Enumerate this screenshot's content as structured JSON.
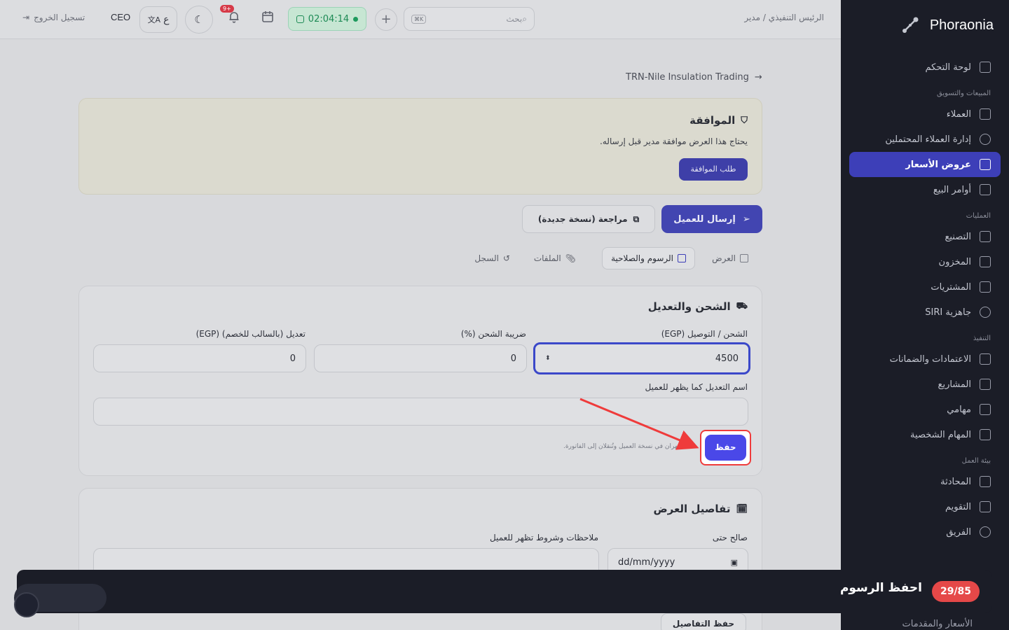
{
  "sidebar": {
    "brand": "Phoraonia",
    "sections": [
      {
        "title": "",
        "items": [
          {
            "label": "لوحة التحكم",
            "icon": "grid-icon",
            "active": false
          }
        ]
      },
      {
        "title": "المبيعات والتسويق",
        "items": [
          {
            "label": "العملاء",
            "icon": "contacts-icon",
            "active": false
          },
          {
            "label": "إدارة العملاء المحتملين",
            "icon": "target-icon",
            "active": false
          },
          {
            "label": "عروض الأسعار",
            "icon": "document-icon",
            "active": true
          },
          {
            "label": "أوامر البيع",
            "icon": "clipboard-icon",
            "active": false
          }
        ]
      },
      {
        "title": "العمليات",
        "items": [
          {
            "label": "التصنيع",
            "icon": "factory-icon",
            "active": false
          },
          {
            "label": "المخزون",
            "icon": "warehouse-icon",
            "active": false
          },
          {
            "label": "المشتريات",
            "icon": "cart-icon",
            "active": false
          },
          {
            "label": "جاهزية SIRI",
            "icon": "gauge-icon",
            "active": false
          }
        ]
      },
      {
        "title": "التنفيذ",
        "items": [
          {
            "label": "الاعتمادات والضمانات",
            "icon": "file-check-icon",
            "active": false
          },
          {
            "label": "المشاريع",
            "icon": "folder-icon",
            "active": false
          },
          {
            "label": "مهامي",
            "icon": "list-check-icon",
            "active": false
          },
          {
            "label": "المهام الشخصية",
            "icon": "clipboard-list-icon",
            "active": false
          }
        ]
      },
      {
        "title": "بيئة العمل",
        "items": [
          {
            "label": "المحادثة",
            "icon": "chat-icon",
            "active": false
          },
          {
            "label": "التقويم",
            "icon": "calendar-icon",
            "active": false
          },
          {
            "label": "الفريق",
            "icon": "users-icon",
            "active": false
          }
        ]
      }
    ],
    "bottom_item": "الأسعار والمقدمات"
  },
  "topbar": {
    "breadcrumb": "الرئيس التنفيذي / مدير",
    "search_placeholder": "بحث",
    "search_shortcut": "K⌘",
    "timer": "02:04:14",
    "notification_count": "+9",
    "lang_label": "ع",
    "role": "CEO",
    "logout": "تسجيل الخروج"
  },
  "main": {
    "back_link": "TRN-Nile Insulation Trading",
    "approval": {
      "title": "الموافقة",
      "text": "يحتاج هذا العرض موافقة مدير قبل إرساله.",
      "button": "طلب الموافقة"
    },
    "actions": {
      "send": "إرسال للعميل",
      "revise": "مراجعة (نسخة جديدة)"
    },
    "tabs": [
      {
        "label": "العرض",
        "icon": "document-icon",
        "active": false
      },
      {
        "label": "الرسوم والصلاحية",
        "icon": "receipt-icon",
        "active": true
      },
      {
        "label": "الملفات",
        "icon": "paperclip-icon",
        "active": false
      },
      {
        "label": "السجل",
        "icon": "history-icon",
        "active": false
      }
    ],
    "shipping": {
      "title": "الشحن والتعديل",
      "shipping_label": "الشحن / التوصيل (EGP)",
      "shipping_value": "4500",
      "tax_label": "ضريبة الشحن (%)",
      "tax_value": "0",
      "adjust_label": "تعديل (بالسالب للخصم) (EGP)",
      "adjust_value": "0",
      "adjust_name_label": "اسم التعديل كما يظهر للعميل",
      "adjust_name_value": "",
      "hint": "تظهران في نسخة العميل وتُنقلان إلى الفاتورة.",
      "save": "حفظ"
    },
    "details": {
      "title": "تفاصيل العرض",
      "valid_until_label": "صالح حتى",
      "valid_until_value": "dd/mm/yyyy",
      "notes_label": "ملاحظات وشروط تظهر للعميل",
      "save": "حفظ التفاصيل"
    }
  },
  "tutorial": {
    "title": "احفظ الرسوم",
    "progress": "29/85"
  },
  "colors": {
    "accent": "#4a48e8",
    "sidebar_bg": "#1b1d27",
    "active_nav": "#3d3fb8",
    "highlight": "#ef3b3b"
  }
}
